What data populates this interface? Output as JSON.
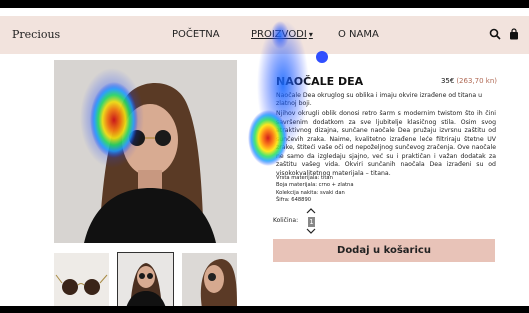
{
  "nav": {
    "logo": "Precious",
    "items": [
      {
        "label": "POČETNA"
      },
      {
        "label": "PROIZVODI"
      },
      {
        "label": "O NAMA"
      }
    ],
    "icons": [
      "search-icon",
      "bag-icon"
    ]
  },
  "product": {
    "title": "NAOČALE DEA",
    "price": "35€",
    "price_alt": "(263,70 kn)",
    "intro": "Naočale Dea okruglog su oblika i imaju okvire izrađene od titana u zlatnoj boji.",
    "description": "Njihov okrugli oblik donosi retro šarm s modernim twistom što ih čini savršenim dodatkom za sve ljubitelje klasičnog stila. Osim svog atraktivnog dizajna, sunčane naočale Dea pružaju izvrsnu zaštitu od sunčevih zraka. Naime, kvalitetno izrađene leće filtriraju štetne UV zrake, štiteći vaše oči od nepoželjnog sunčevog zračenja. Ove naočale ne samo da izgledaju sjajno, već su i praktičan i važan dodatak za zaštitu vašeg vida. Okviri sunčanih naočala Dea izrađeni su od visokokvalitetnog materijala – titana.",
    "specs": [
      "Vrsta materijala: titan",
      "Boja materijala: crno + zlatna",
      "Kolekcija nakita: svaki dan",
      "Šifra: 648890"
    ],
    "qty_label": "Količina:",
    "qty_value": "1",
    "cart_button": "Dodaj u košaricu"
  },
  "colors": {
    "nav_bg": "#f2e3dd",
    "button_bg": "#e8c3b8"
  }
}
